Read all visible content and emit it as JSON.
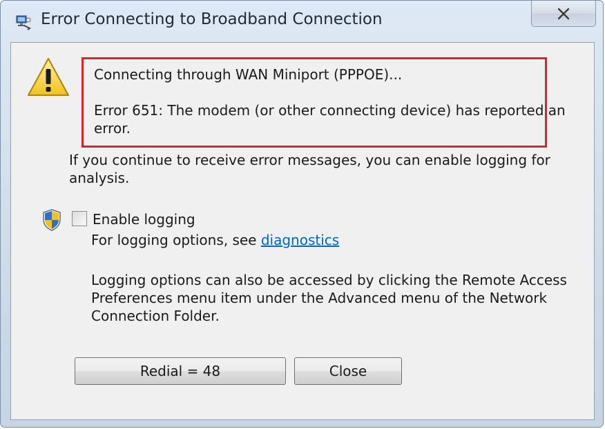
{
  "window": {
    "title": "Error Connecting to Broadband Connection",
    "title_icon": "network-connection-icon",
    "close_glyph": "✕",
    "close_icon": "close-icon"
  },
  "message": {
    "icon": "warning-icon",
    "connecting_line": "Connecting through WAN Miniport (PPPOE)...",
    "error_line_1": "Error 651: The modem (or other connecting device) has reported an",
    "error_line_2": "error.",
    "highlight_color": "#d8242f"
  },
  "info": {
    "line_1": "If you continue to receive error messages, you can enable logging for",
    "line_2": "analysis."
  },
  "logging": {
    "shield_icon": "uac-shield-icon",
    "checkbox_label": "Enable logging",
    "checked": false,
    "options_prefix": "For logging options, see ",
    "diagnostics_link": "diagnostics",
    "note_line_1": "Logging options can also be accessed by clicking the Remote Access",
    "note_line_2": "Preferences menu item under the Advanced menu of the Network",
    "note_line_3": "Connection Folder."
  },
  "buttons": {
    "redial_label": "Redial = 48",
    "close_label": "Close"
  }
}
